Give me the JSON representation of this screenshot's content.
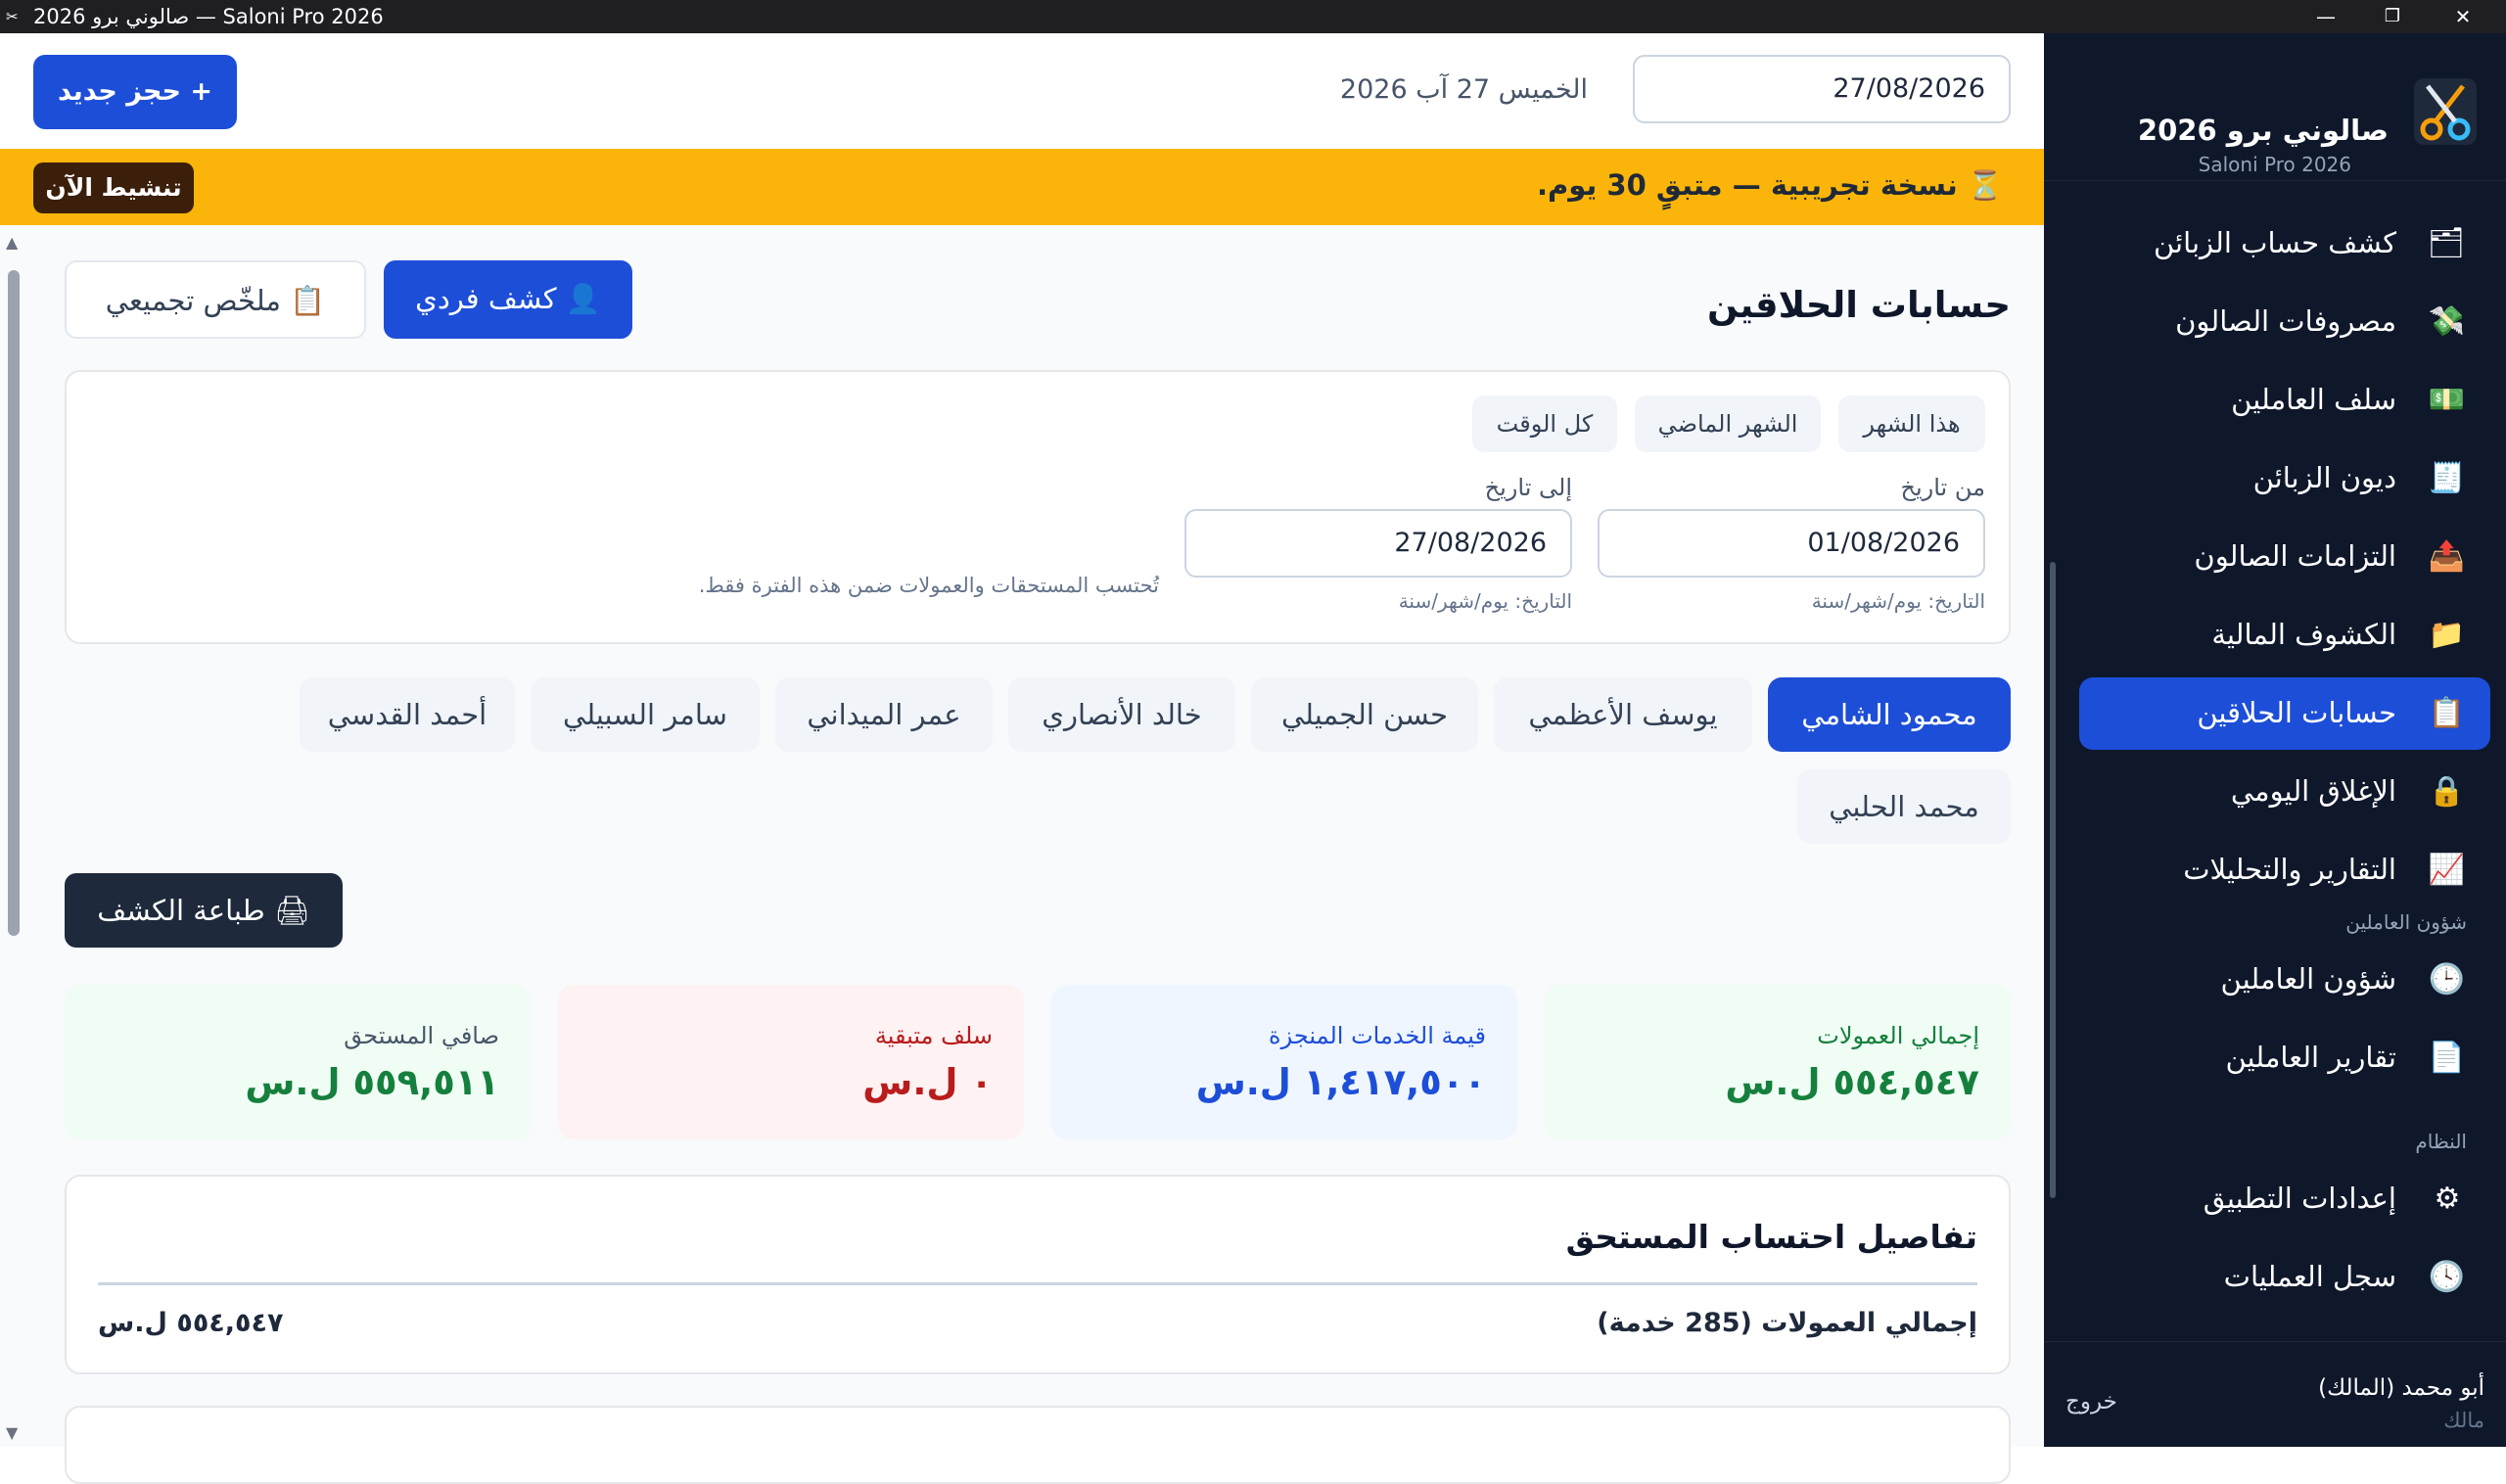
{
  "window": {
    "title": "صالوني برو 2026 — Saloni Pro 2026",
    "minimize": "—",
    "maximize": "❐",
    "close": "✕"
  },
  "sidebar": {
    "brand_title": "صالوني برو 2026",
    "brand_subtitle": "Saloni Pro 2026",
    "items": [
      {
        "label": "كشف حساب الزبائن",
        "icon": "🗂",
        "icon_name": "ledger-icon"
      },
      {
        "label": "مصروفات الصالون",
        "icon": "💸",
        "icon_name": "money-wings-icon"
      },
      {
        "label": "سلف العاملين",
        "icon": "💵",
        "icon_name": "cash-icon"
      },
      {
        "label": "ديون الزبائن",
        "icon": "🧾",
        "icon_name": "receipt-icon"
      },
      {
        "label": "التزامات الصالون",
        "icon": "📤",
        "icon_name": "outbox-icon"
      },
      {
        "label": "الكشوف المالية",
        "icon": "📁",
        "icon_name": "folder-icon"
      },
      {
        "label": "حسابات الحلاقين",
        "icon": "📋",
        "icon_name": "clipboard-icon"
      },
      {
        "label": "الإغلاق اليومي",
        "icon": "🔒",
        "icon_name": "lock-icon"
      },
      {
        "label": "التقارير والتحليلات",
        "icon": "📈",
        "icon_name": "chart-up-icon"
      }
    ],
    "section_staff": "شؤون العاملين",
    "staff_items": [
      {
        "label": "شؤون العاملين",
        "icon": "🕒",
        "icon_name": "clock-icon"
      },
      {
        "label": "تقارير العاملين",
        "icon": "📄",
        "icon_name": "document-icon"
      }
    ],
    "section_system": "النظام",
    "system_items": [
      {
        "label": "إعدادات التطبيق",
        "icon": "⚙",
        "icon_name": "gear-icon"
      },
      {
        "label": "سجل العمليات",
        "icon": "🕓",
        "icon_name": "history-icon"
      }
    ],
    "user_name": "أبو محمد (المالك)",
    "user_role": "مالك",
    "logout": "خروج"
  },
  "topbar": {
    "date_value": "27/08/2026",
    "date_text": "الخميس 27 آب 2026",
    "new_booking": "+ حجز جديد"
  },
  "trial": {
    "message": "⏳ نسخة تجريبية — متبقٍ 30 يوم.",
    "activate": "تنشيط الآن"
  },
  "page": {
    "title": "حسابات الحلاقين",
    "tab_individual": "👤 كشف فردي",
    "tab_summary": "📋 ملخّص تجميعي"
  },
  "filters": {
    "quick": [
      "هذا الشهر",
      "الشهر الماضي",
      "كل الوقت"
    ],
    "from_label": "من تاريخ",
    "from_value": "01/08/2026",
    "from_hint": "التاريخ: يوم/شهر/سنة",
    "to_label": "إلى تاريخ",
    "to_value": "27/08/2026",
    "to_hint": "التاريخ: يوم/شهر/سنة",
    "note": "تُحتسب المستحقات والعمولات ضمن هذه الفترة فقط."
  },
  "barbers": [
    "محمود الشامي",
    "يوسف الأعظمي",
    "حسن الجميلي",
    "خالد الأنصاري",
    "عمر الميداني",
    "سامر السبيلي",
    "أحمد القدسي",
    "محمد الحلبي"
  ],
  "print_button": "🖨 طباعة الكشف",
  "stats": [
    {
      "label": "إجمالي العمولات",
      "value": "٥٥٤,٥٤٧ ل.س",
      "bg": "#f0fdf4",
      "label_color": "#15803d",
      "value_color": "#15803d"
    },
    {
      "label": "قيمة الخدمات المنجزة",
      "value": "١,٤١٧,٥٠٠ ل.س",
      "bg": "#eff6ff",
      "label_color": "#1d4ed8",
      "value_color": "#1d4ed8"
    },
    {
      "label": "سلف متبقية",
      "value": "٠ ل.س",
      "bg": "#fef2f2",
      "label_color": "#b91c1c",
      "value_color": "#b91c1c"
    },
    {
      "label": "صافي المستحق",
      "value": "٥٥٩,٥١١ ل.س",
      "bg": "#f0fdf4",
      "label_color": "#475569",
      "value_color": "#15803d"
    }
  ],
  "details": {
    "title": "تفاصيل احتساب المستحق",
    "row_label": "إجمالي العمولات (285 خدمة)",
    "row_value": "٥٥٤,٥٤٧ ل.س"
  },
  "colors": {
    "accent": "#1d4ed8",
    "sidebar_bg": "#0f172a",
    "trial_bg": "#fbb50a"
  }
}
